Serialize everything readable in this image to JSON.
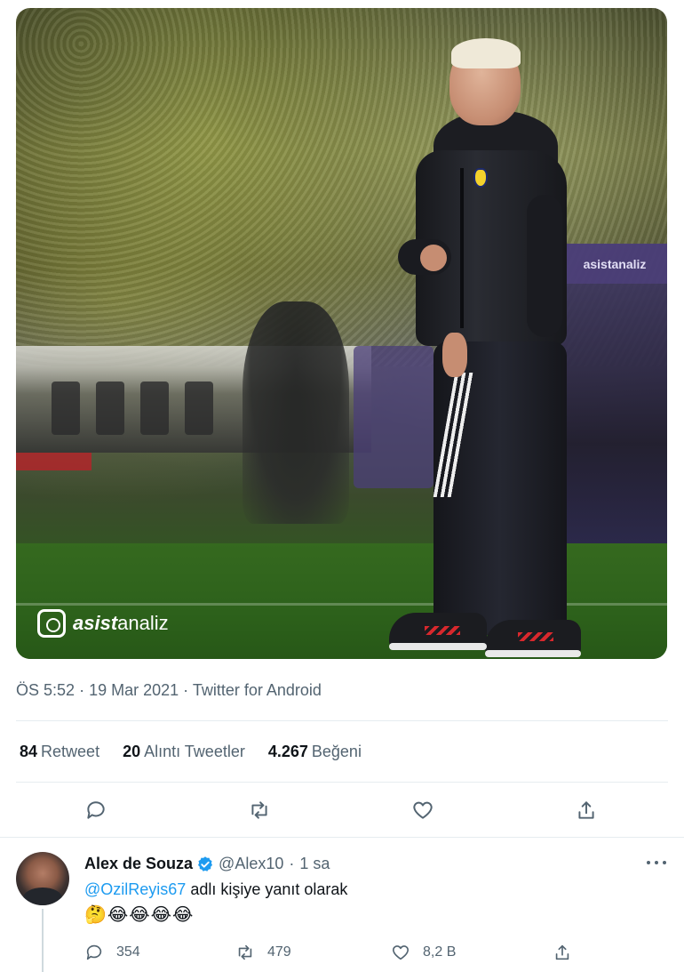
{
  "media": {
    "watermark_strong": "asist",
    "watermark_light": "analiz",
    "board_text": "asistanaliz"
  },
  "tweet": {
    "time": "ÖS 5:52",
    "date": "19 Mar 2021",
    "source": "Twitter for Android",
    "sep": "·",
    "stats": {
      "retweets_count": "84",
      "retweets_label": "Retweet",
      "quotes_count": "20",
      "quotes_label": "Alıntı Tweetler",
      "likes_count": "4.267",
      "likes_label": "Beğeni"
    },
    "actions": [
      "reply-icon",
      "retweet-icon",
      "like-icon",
      "share-icon"
    ]
  },
  "reply": {
    "name": "Alex de Souza",
    "handle": "@Alex10",
    "dot": "·",
    "time": "1 sa",
    "reply_mention": "@OzilReyis67",
    "reply_suffix": " adlı kişiye yanıt olarak",
    "text": "🤔😂😂😂😂",
    "reply_count": "354",
    "retweet_count": "479",
    "like_count": "8,2 B",
    "verified_color": "#1d9bf0"
  }
}
